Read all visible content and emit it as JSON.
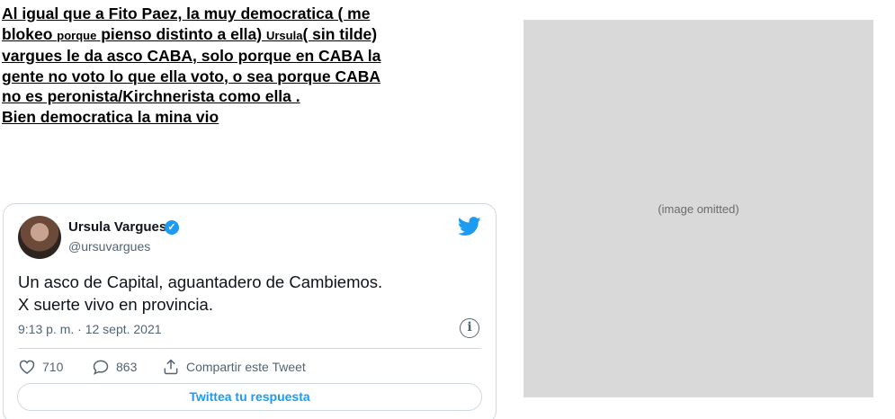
{
  "caption": {
    "line1": "Al igual que a Fito Paez, la muy democratica ( me",
    "line2_a": "blokeo ",
    "line2_b": "porque",
    "line2_c": " pienso distinto a ella) ",
    "line2_d": "Ursula",
    "line2_e": "( sin tilde)",
    "line3": "vargues le da asco CABA, solo porque en CABA la",
    "line4": "gente no voto lo que ella voto, o sea porque CABA",
    "line5": "no es peronista/Kirchnerista  como ella .",
    "line6": "Bien democratica la mina vio"
  },
  "tweet": {
    "author_name": "Ursula Vargues",
    "handle": "@ursuvargues",
    "text_lines": [
      "Un asco de Capital, aguantadero de Cambiemos.",
      "X suerte vivo en provincia."
    ],
    "timestamp": "9:13 p. m. · 12 sept. 2021",
    "likes": "710",
    "replies": "863",
    "share_label": "Compartir este Tweet",
    "reply_button_label": "Twittea tu respuesta",
    "verified_icon": "check-icon",
    "brand_color": "#1d9bf0"
  },
  "photo": {
    "omitted_label": "(image omitted)"
  }
}
